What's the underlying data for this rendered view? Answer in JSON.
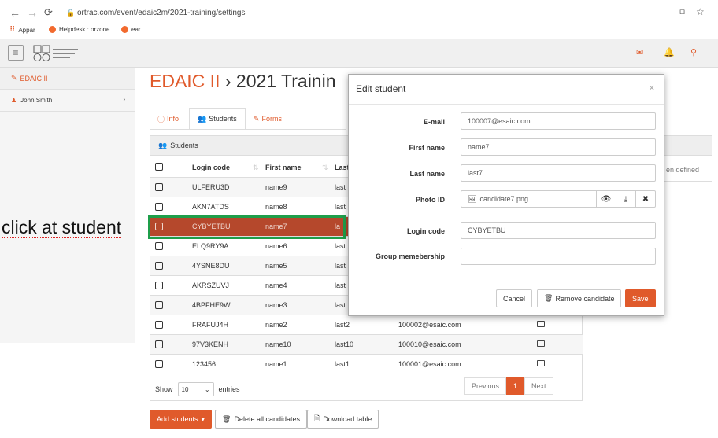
{
  "browser": {
    "url": "ortrac.com/event/edaic2m/2021-training/settings",
    "bookmarks": [
      "Appar",
      "Helpdesk : orzone",
      "ear"
    ]
  },
  "sidebar": {
    "items": [
      {
        "label": "EDAIC II",
        "icon": "edit-icon"
      },
      {
        "label": "John Smith",
        "icon": "user-icon"
      }
    ]
  },
  "page": {
    "title_prefix": "EDAIC II",
    "title_rest": " › 2021 Trainin",
    "tabs": [
      {
        "label": "Info",
        "icon": "info-icon"
      },
      {
        "label": "Students",
        "icon": "users-icon"
      },
      {
        "label": "Forms",
        "icon": "edit-icon"
      }
    ],
    "panel_title": "Students",
    "right_panel_text": "en defined"
  },
  "table": {
    "headers": [
      "Login code",
      "First name",
      "Last"
    ],
    "rows": [
      {
        "code": "ULFERU3D",
        "first": "name9",
        "last": "last",
        "email": "",
        "photo": false
      },
      {
        "code": "AKN7ATDS",
        "first": "name8",
        "last": "last",
        "email": "",
        "photo": false
      },
      {
        "code": "CYBYETBU",
        "first": "name7",
        "last": "la",
        "email": "",
        "photo": false,
        "selected": true
      },
      {
        "code": "ELQ9RY9A",
        "first": "name6",
        "last": "last",
        "email": "",
        "photo": false
      },
      {
        "code": "4YSNE8DU",
        "first": "name5",
        "last": "last",
        "email": "",
        "photo": false
      },
      {
        "code": "AKRSZUVJ",
        "first": "name4",
        "last": "last",
        "email": "",
        "photo": false
      },
      {
        "code": "4BPFHE9W",
        "first": "name3",
        "last": "last",
        "email": "",
        "photo": false
      },
      {
        "code": "FRAFUJ4H",
        "first": "name2",
        "last": "last2",
        "email": "100002@esaic.com",
        "photo": true
      },
      {
        "code": "97V3KENH",
        "first": "name10",
        "last": "last10",
        "email": "100010@esaic.com",
        "photo": true
      },
      {
        "code": "123456",
        "first": "name1",
        "last": "last1",
        "email": "100001@esaic.com",
        "photo": true
      }
    ],
    "show_label": "Show",
    "entries_value": "10",
    "entries_label": "entries",
    "pager": {
      "prev": "Previous",
      "current": "1",
      "next": "Next"
    }
  },
  "actions": {
    "add": "Add students",
    "delete": "Delete all candidates",
    "download": "Download table"
  },
  "modal": {
    "title": "Edit student",
    "close": "×",
    "fields": {
      "email_label": "E-mail",
      "email_value": "100007@esaic.com",
      "first_label": "First name",
      "first_value": "name7",
      "last_label": "Last name",
      "last_value": "last7",
      "photo_label": "Photo ID",
      "photo_value": "candidate7.png",
      "login_label": "Login code",
      "login_value": "CYBYETBU",
      "group_label": "Group memebership",
      "group_value": ""
    },
    "buttons": {
      "cancel": "Cancel",
      "remove": "Remove candidate",
      "save": "Save"
    }
  },
  "annotation": {
    "text": "click at student"
  },
  "colors": {
    "accent": "#e05a2b",
    "selected_row": "#b5482c",
    "highlight": "#1e9e4a"
  }
}
